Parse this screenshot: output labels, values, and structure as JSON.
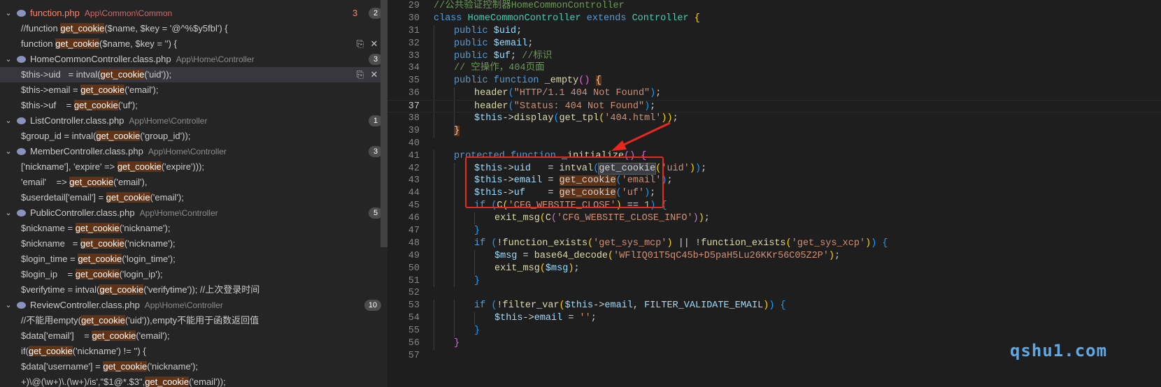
{
  "search_results": [
    {
      "type": "file",
      "expanded": true,
      "name": "function.php",
      "path": "App\\Common\\Common",
      "error_count": "3",
      "badge": "2",
      "error": true
    },
    {
      "type": "match",
      "pre": "//function ",
      "match": "get_cookie",
      "post": "($name, $key = '@^%$y5fbl') {"
    },
    {
      "type": "match",
      "pre": "function ",
      "match": "get_cookie",
      "post": "($name, $key = '') {",
      "actions": [
        "replace-icon",
        "dismiss-icon"
      ]
    },
    {
      "type": "file",
      "expanded": true,
      "name": "HomeCommonController.class.php",
      "path": "App\\Home\\Controller",
      "badge": "3"
    },
    {
      "type": "match",
      "pre": "$this->uid   = intval(",
      "match": "get_cookie",
      "post": "('uid'));",
      "selected": true,
      "actions": [
        "replace-icon",
        "dismiss-icon"
      ]
    },
    {
      "type": "match",
      "pre": "$this->email = ",
      "match": "get_cookie",
      "post": "('email');"
    },
    {
      "type": "match",
      "pre": "$this->uf    = ",
      "match": "get_cookie",
      "post": "('uf');"
    },
    {
      "type": "file",
      "expanded": true,
      "name": "ListController.class.php",
      "path": "App\\Home\\Controller",
      "badge": "1"
    },
    {
      "type": "match",
      "pre": "$group_id = intval(",
      "match": "get_cookie",
      "post": "('group_id'));"
    },
    {
      "type": "file",
      "expanded": true,
      "name": "MemberController.class.php",
      "path": "App\\Home\\Controller",
      "badge": "3"
    },
    {
      "type": "match",
      "pre": "['nickname'], 'expire' => ",
      "match": "get_cookie",
      "post": "('expire')));"
    },
    {
      "type": "match",
      "pre": "'email'    => ",
      "match": "get_cookie",
      "post": "('email'),"
    },
    {
      "type": "match",
      "pre": "$userdetail['email'] = ",
      "match": "get_cookie",
      "post": "('email');"
    },
    {
      "type": "file",
      "expanded": true,
      "name": "PublicController.class.php",
      "path": "App\\Home\\Controller",
      "badge": "5"
    },
    {
      "type": "match",
      "pre": "$nickname = ",
      "match": "get_cookie",
      "post": "('nickname');"
    },
    {
      "type": "match",
      "pre": "$nickname   = ",
      "match": "get_cookie",
      "post": "('nickname');"
    },
    {
      "type": "match",
      "pre": "$login_time = ",
      "match": "get_cookie",
      "post": "('login_time');"
    },
    {
      "type": "match",
      "pre": "$login_ip    = ",
      "match": "get_cookie",
      "post": "('login_ip');"
    },
    {
      "type": "match",
      "pre": "$verifytime = intval(",
      "match": "get_cookie",
      "post": "('verifytime')); //上次登录时间"
    },
    {
      "type": "file",
      "expanded": true,
      "name": "ReviewController.class.php",
      "path": "App\\Home\\Controller",
      "badge": "10"
    },
    {
      "type": "match",
      "pre": "//不能用empty(",
      "match": "get_cookie",
      "post": "('uid')),empty不能用于函数返回值"
    },
    {
      "type": "match",
      "pre": "$data['email']    = ",
      "match": "get_cookie",
      "post": "('email');"
    },
    {
      "type": "match",
      "pre": "if(",
      "match": "get_cookie",
      "post": "('nickname') != '') {"
    },
    {
      "type": "match",
      "pre": "$data['username'] = ",
      "match": "get_cookie",
      "post": "('nickname');"
    },
    {
      "type": "match",
      "pre": "+)\\@(\\w+)\\.(\\w+)/is',\"$1@*.$3\",",
      "match": "get_cookie",
      "post": "('email'));"
    }
  ],
  "editor": {
    "current_line": "37",
    "lines": [
      {
        "n": "29",
        "i": 0,
        "t": [
          [
            "cm",
            "//公共验证控制器HomeCommonController"
          ]
        ]
      },
      {
        "n": "30",
        "i": 0,
        "t": [
          [
            "kw",
            "class "
          ],
          [
            "ty",
            "HomeCommonController "
          ],
          [
            "kw",
            "extends "
          ],
          [
            "ty",
            "Controller "
          ],
          [
            "b1",
            "{"
          ]
        ]
      },
      {
        "n": "31",
        "i": 1,
        "t": [
          [
            "kw",
            "public "
          ],
          [
            "vr",
            "$uid"
          ],
          [
            "pn",
            ";"
          ]
        ]
      },
      {
        "n": "32",
        "i": 1,
        "t": [
          [
            "kw",
            "public "
          ],
          [
            "vr",
            "$email"
          ],
          [
            "pn",
            ";"
          ]
        ]
      },
      {
        "n": "33",
        "i": 1,
        "t": [
          [
            "kw",
            "public "
          ],
          [
            "vr",
            "$uf"
          ],
          [
            "pn",
            "; "
          ],
          [
            "cm",
            "//标识"
          ]
        ]
      },
      {
        "n": "34",
        "i": 1,
        "t": [
          [
            "cm",
            "// 空操作，404页面"
          ]
        ]
      },
      {
        "n": "35",
        "i": 1,
        "t": [
          [
            "kw",
            "public "
          ],
          [
            "kw",
            "function "
          ],
          [
            "fnc",
            "_empty"
          ],
          [
            "b2",
            "() "
          ],
          [
            "hi",
            "{"
          ]
        ]
      },
      {
        "n": "36",
        "i": 2,
        "t": [
          [
            "fnc",
            "header"
          ],
          [
            "b3",
            "("
          ],
          [
            "st",
            "\"HTTP/1.1 404 Not Found\""
          ],
          [
            "b3",
            ")"
          ],
          [
            "pn",
            ";"
          ]
        ]
      },
      {
        "n": "37",
        "i": 2,
        "t": [
          [
            "fnc",
            "header"
          ],
          [
            "b3",
            "("
          ],
          [
            "st",
            "\"Status: 404 Not Found\""
          ],
          [
            "b3",
            ")"
          ],
          [
            "pn",
            ";"
          ]
        ]
      },
      {
        "n": "38",
        "i": 2,
        "t": [
          [
            "vr",
            "$this"
          ],
          [
            "pn",
            "->"
          ],
          [
            "fnc",
            "display"
          ],
          [
            "b3",
            "("
          ],
          [
            "fnc",
            "get_tpl"
          ],
          [
            "b1",
            "("
          ],
          [
            "st",
            "'404.html'"
          ],
          [
            "b1",
            "))"
          ],
          [
            "pn",
            ";"
          ]
        ]
      },
      {
        "n": "39",
        "i": 1,
        "t": [
          [
            "hi",
            "}"
          ]
        ]
      },
      {
        "n": "40",
        "i": 0,
        "t": []
      },
      {
        "n": "41",
        "i": 1,
        "t": [
          [
            "kw",
            "protected "
          ],
          [
            "kw",
            "function "
          ],
          [
            "fnc",
            "_initialize"
          ],
          [
            "b2",
            "() "
          ],
          [
            "b2",
            "{"
          ]
        ]
      },
      {
        "n": "42",
        "i": 2,
        "t": [
          [
            "vr",
            "$this"
          ],
          [
            "pn",
            "->"
          ],
          [
            "vr",
            "uid   "
          ],
          [
            "pn",
            "= "
          ],
          [
            "fnc",
            "intval"
          ],
          [
            "b3",
            "("
          ],
          [
            "hi2",
            "get_cookie"
          ],
          [
            "b1",
            "("
          ],
          [
            "st",
            "'uid'"
          ],
          [
            "b1",
            ")"
          ],
          [
            "b3",
            ")"
          ],
          [
            "pn",
            ";"
          ]
        ]
      },
      {
        "n": "43",
        "i": 2,
        "t": [
          [
            "vr",
            "$this"
          ],
          [
            "pn",
            "->"
          ],
          [
            "vr",
            "email "
          ],
          [
            "pn",
            "= "
          ],
          [
            "hi",
            "get_cookie"
          ],
          [
            "b3",
            "("
          ],
          [
            "st",
            "'email'"
          ],
          [
            "b3",
            ")"
          ],
          [
            "pn",
            ";"
          ]
        ]
      },
      {
        "n": "44",
        "i": 2,
        "t": [
          [
            "vr",
            "$this"
          ],
          [
            "pn",
            "->"
          ],
          [
            "vr",
            "uf    "
          ],
          [
            "pn",
            "= "
          ],
          [
            "hi",
            "get_cookie"
          ],
          [
            "b3",
            "("
          ],
          [
            "st",
            "'uf'"
          ],
          [
            "b3",
            ")"
          ],
          [
            "pn",
            ";"
          ]
        ]
      },
      {
        "n": "45",
        "i": 2,
        "t": [
          [
            "kw",
            "if "
          ],
          [
            "b3",
            "("
          ],
          [
            "fnc",
            "C"
          ],
          [
            "b1",
            "("
          ],
          [
            "st",
            "'CFG_WEBSITE_CLOSE'"
          ],
          [
            "b1",
            ") "
          ],
          [
            "pn",
            "== "
          ],
          [
            "nm",
            "1"
          ],
          [
            "b3",
            ") "
          ],
          [
            "b3",
            "{"
          ]
        ]
      },
      {
        "n": "46",
        "i": 3,
        "t": [
          [
            "fnc",
            "exit_msg"
          ],
          [
            "b1",
            "("
          ],
          [
            "fnc",
            "C"
          ],
          [
            "b2",
            "("
          ],
          [
            "st",
            "'CFG_WEBSITE_CLOSE_INFO'"
          ],
          [
            "b2",
            ")"
          ],
          [
            "b1",
            ")"
          ],
          [
            "pn",
            ";"
          ]
        ]
      },
      {
        "n": "47",
        "i": 2,
        "t": [
          [
            "b3",
            "}"
          ]
        ]
      },
      {
        "n": "48",
        "i": 2,
        "t": [
          [
            "kw",
            "if "
          ],
          [
            "b3",
            "("
          ],
          [
            "pn",
            "!"
          ],
          [
            "fnc",
            "function_exists"
          ],
          [
            "b1",
            "("
          ],
          [
            "st",
            "'get_sys_mcp'"
          ],
          [
            "b1",
            ") "
          ],
          [
            "pn",
            "|| !"
          ],
          [
            "fnc",
            "function_exists"
          ],
          [
            "b1",
            "("
          ],
          [
            "st",
            "'get_sys_xcp'"
          ],
          [
            "b1",
            ")"
          ],
          [
            "b3",
            ") "
          ],
          [
            "b3",
            "{"
          ]
        ]
      },
      {
        "n": "49",
        "i": 3,
        "t": [
          [
            "vr",
            "$msg "
          ],
          [
            "pn",
            "= "
          ],
          [
            "fnc",
            "base64_decode"
          ],
          [
            "b1",
            "("
          ],
          [
            "st",
            "'WFlIQ01T5qC45b+D5paH5Lu26KKr56C05Z2P'"
          ],
          [
            "b1",
            ")"
          ],
          [
            "pn",
            ";"
          ]
        ]
      },
      {
        "n": "50",
        "i": 3,
        "t": [
          [
            "fnc",
            "exit_msg"
          ],
          [
            "b1",
            "("
          ],
          [
            "vr",
            "$msg"
          ],
          [
            "b1",
            ")"
          ],
          [
            "pn",
            ";"
          ]
        ]
      },
      {
        "n": "51",
        "i": 2,
        "t": [
          [
            "b3",
            "}"
          ]
        ]
      },
      {
        "n": "52",
        "i": 0,
        "t": []
      },
      {
        "n": "53",
        "i": 2,
        "t": [
          [
            "kw",
            "if "
          ],
          [
            "b3",
            "("
          ],
          [
            "pn",
            "!"
          ],
          [
            "fnc",
            "filter_var"
          ],
          [
            "b1",
            "("
          ],
          [
            "vr",
            "$this"
          ],
          [
            "pn",
            "->"
          ],
          [
            "vr",
            "email"
          ],
          [
            "pn",
            ", "
          ],
          [
            "vr",
            "FILTER_VALIDATE_EMAIL"
          ],
          [
            "b1",
            ")"
          ],
          [
            "b3",
            ") "
          ],
          [
            "b3",
            "{"
          ]
        ]
      },
      {
        "n": "54",
        "i": 3,
        "t": [
          [
            "vr",
            "$this"
          ],
          [
            "pn",
            "->"
          ],
          [
            "vr",
            "email "
          ],
          [
            "pn",
            "= "
          ],
          [
            "st",
            "''"
          ],
          [
            "pn",
            ";"
          ]
        ]
      },
      {
        "n": "55",
        "i": 2,
        "t": [
          [
            "b3",
            "}"
          ]
        ]
      },
      {
        "n": "56",
        "i": 1,
        "t": [
          [
            "b2",
            "}"
          ]
        ]
      },
      {
        "n": "57",
        "i": 0,
        "t": []
      }
    ]
  },
  "watermark": "qshu1.com",
  "colors": {
    "accent": "#f48771",
    "annotation": "#e8281f",
    "match_bg": "#623315"
  }
}
